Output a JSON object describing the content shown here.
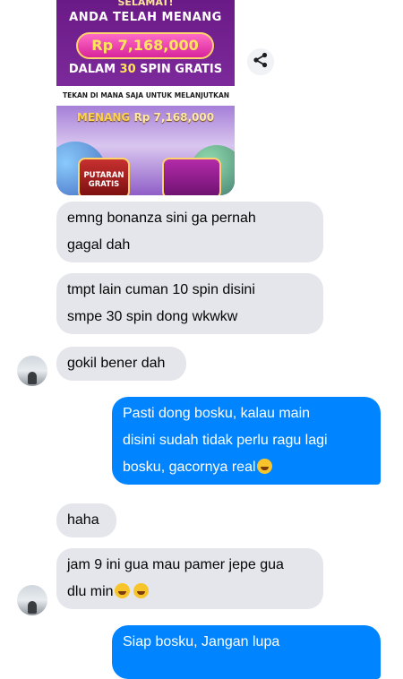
{
  "promo": {
    "congrats": "SELAMAT!",
    "won": "ANDA TELAH MENANG",
    "amount": "Rp 7,168,000",
    "spins_prefix": "DALAM ",
    "spins_count": "30",
    "spins_suffix": " SPIN GRATIS",
    "notice": "TEKAN DI MANA SAJA UNTUK MELANJUTKAN",
    "menang_label": "MENANG",
    "menang_amount": "Rp 7,168,000",
    "free_button": "PUTARAN GRATIS"
  },
  "messages": [
    {
      "direction": "incoming",
      "lines": [
        "emng bonanza sini ga pernah",
        "gagal dah"
      ]
    },
    {
      "direction": "incoming",
      "lines": [
        "tmpt lain cuman 10 spin disini",
        "smpe 30 spin dong wkwkw"
      ]
    },
    {
      "direction": "incoming",
      "lines": [
        "gokil bener dah"
      ]
    },
    {
      "direction": "outgoing",
      "lines": [
        "Pasti dong bosku, kalau main",
        "disini sudah tidak perlu ragu lagi",
        "bosku, gacornya real"
      ]
    },
    {
      "direction": "incoming",
      "lines": [
        "haha"
      ]
    },
    {
      "direction": "incoming",
      "lines": [
        "jam 9 ini gua mau pamer jepe gua",
        "dlu min"
      ]
    },
    {
      "direction": "outgoing",
      "lines": [
        "Siap bosku, Jangan lupa"
      ]
    }
  ],
  "icons": {
    "share": "share-icon",
    "emoji_yum": "yum-emoji-icon",
    "emoji_rofl": "rofl-emoji-icon",
    "avatar": "avatar"
  },
  "colors": {
    "outgoing_bubble": "#0084ff",
    "incoming_bubble": "#e4e6eb"
  }
}
